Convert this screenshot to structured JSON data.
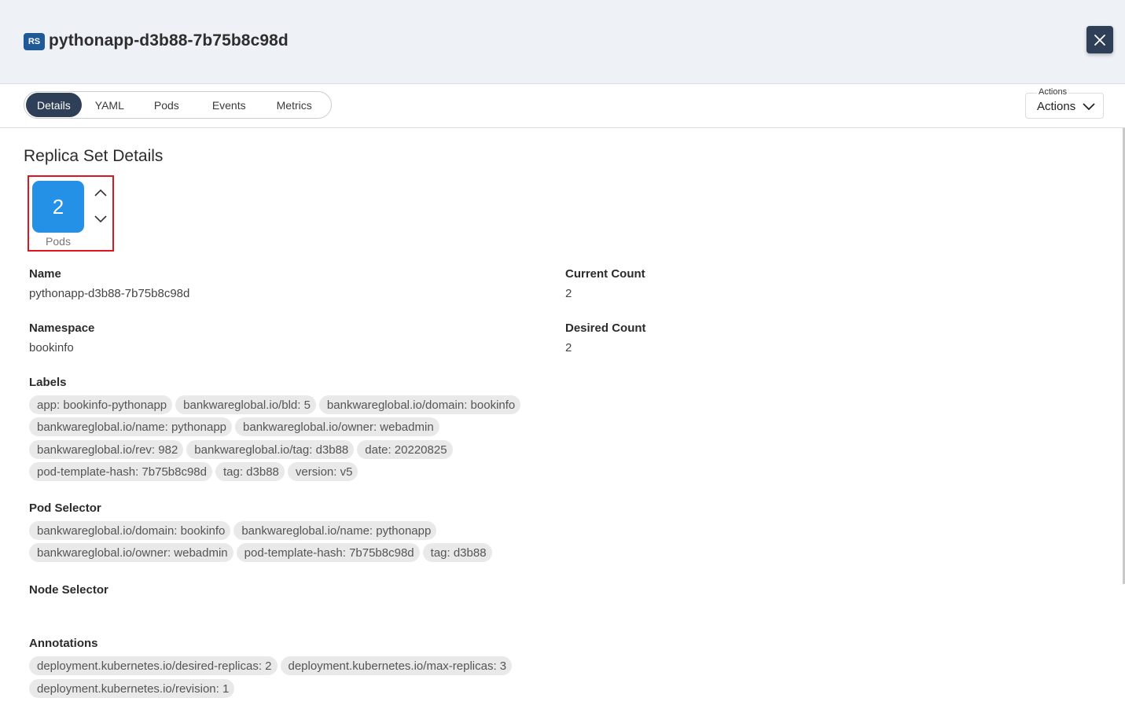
{
  "header": {
    "kind_badge": "RS",
    "title": "pythonapp-d3b88-7b75b8c98d",
    "close_icon": "close-icon"
  },
  "tabs": [
    "Details",
    "YAML",
    "Pods",
    "Events",
    "Metrics"
  ],
  "active_tab": "Details",
  "actions": {
    "caption": "Actions",
    "label": "Actions",
    "icon": "chevron-down-icon"
  },
  "section_title": "Replica Set Details",
  "scaler": {
    "count": "2",
    "label": "Pods"
  },
  "fields": {
    "name": {
      "label": "Name",
      "value": "pythonapp-d3b88-7b75b8c98d"
    },
    "namespace": {
      "label": "Namespace",
      "value": "bookinfo"
    },
    "current_count": {
      "label": "Current Count",
      "value": "2"
    },
    "desired_count": {
      "label": "Desired Count",
      "value": "2"
    }
  },
  "labels": {
    "label": "Labels",
    "rows": [
      [
        "app: bookinfo-pythonapp",
        "bankwareglobal.io/bld: 5",
        "bankwareglobal.io/domain: bookinfo"
      ],
      [
        "bankwareglobal.io/name: pythonapp",
        "bankwareglobal.io/owner: webadmin"
      ],
      [
        "bankwareglobal.io/rev: 982",
        "bankwareglobal.io/tag: d3b88",
        "date: 20220825"
      ],
      [
        "pod-template-hash: 7b75b8c98d",
        "tag: d3b88",
        "version: v5"
      ]
    ]
  },
  "pod_selector": {
    "label": "Pod Selector",
    "rows": [
      [
        "bankwareglobal.io/domain: bookinfo",
        "bankwareglobal.io/name: pythonapp"
      ],
      [
        "bankwareglobal.io/owner: webadmin",
        "pod-template-hash: 7b75b8c98d",
        "tag: d3b88"
      ]
    ]
  },
  "node_selector": {
    "label": "Node Selector"
  },
  "annotations": {
    "label": "Annotations",
    "rows": [
      [
        "deployment.kubernetes.io/desired-replicas: 2",
        "deployment.kubernetes.io/max-replicas: 3"
      ],
      [
        "deployment.kubernetes.io/revision: 1"
      ]
    ]
  }
}
